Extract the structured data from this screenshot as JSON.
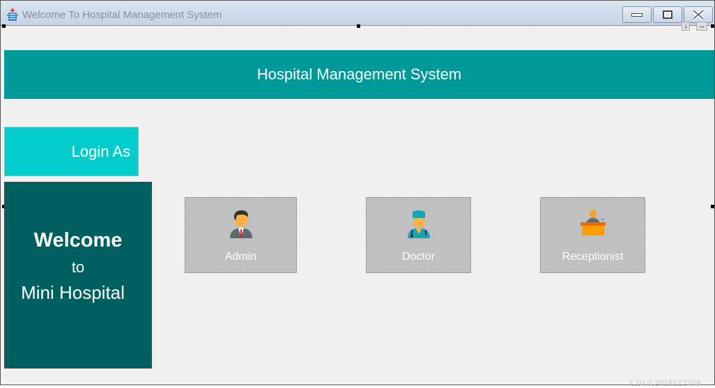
{
  "window": {
    "title": "Welcome To Hospital Management System",
    "icon": "hospital-building-icon"
  },
  "header": {
    "title": "Hospital Management System",
    "color": "#009999"
  },
  "login": {
    "label": "Login As",
    "color": "#00cccc"
  },
  "welcome": {
    "line1": "Welcome",
    "line2": "to",
    "line3": "Mini Hospital",
    "color": "#006060"
  },
  "roles": [
    {
      "label": "Admin",
      "icon": "admin-user-icon"
    },
    {
      "label": "Doctor",
      "icon": "doctor-icon"
    },
    {
      "label": "Receptionist",
      "icon": "receptionist-icon"
    }
  ],
  "version": "1.10.0.2018122709",
  "markers": {
    "down": "↓",
    "horizontal": "↔"
  }
}
